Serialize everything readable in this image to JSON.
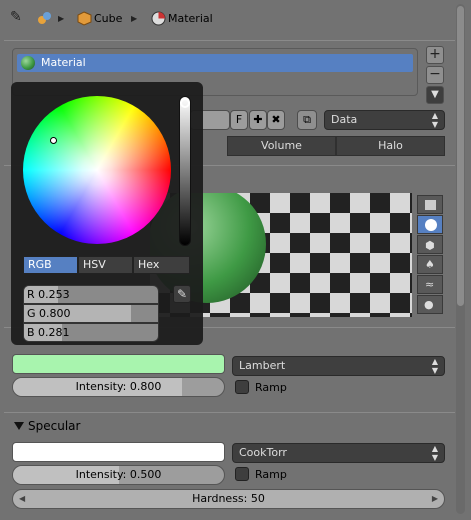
{
  "breadcrumb": {
    "items": [
      "Cube",
      "Material"
    ]
  },
  "material_list": {
    "selected": "Material"
  },
  "sidebar_buttons": {
    "add": "+",
    "remove": "−",
    "menu": "▼"
  },
  "datablock": {
    "f_label": "F",
    "link_value": "Data"
  },
  "context_tabs": [
    "Volume",
    "Halo"
  ],
  "color_picker": {
    "tabs": [
      "RGB",
      "HSV",
      "Hex"
    ],
    "active_tab": "RGB",
    "r_label": "R 0.253",
    "g_label": "G 0.800",
    "b_label": "B 0.281",
    "r": 0.253,
    "g": 0.8,
    "b": 0.281,
    "value_level": 0.99
  },
  "diffuse": {
    "color": "#a8f4ae",
    "shader": "Lambert",
    "intensity_label": "Intensity: 0.800",
    "intensity": 0.8,
    "ramp_label": "Ramp"
  },
  "specular": {
    "title": "Specular",
    "color": "#ffffff",
    "shader": "CookTorr",
    "intensity_label": "Intensity: 0.500",
    "intensity": 0.5,
    "ramp_label": "Ramp",
    "hardness_label": "Hardness: 50"
  },
  "colors": {
    "accent": "#5680c2",
    "panel": "#727272"
  }
}
